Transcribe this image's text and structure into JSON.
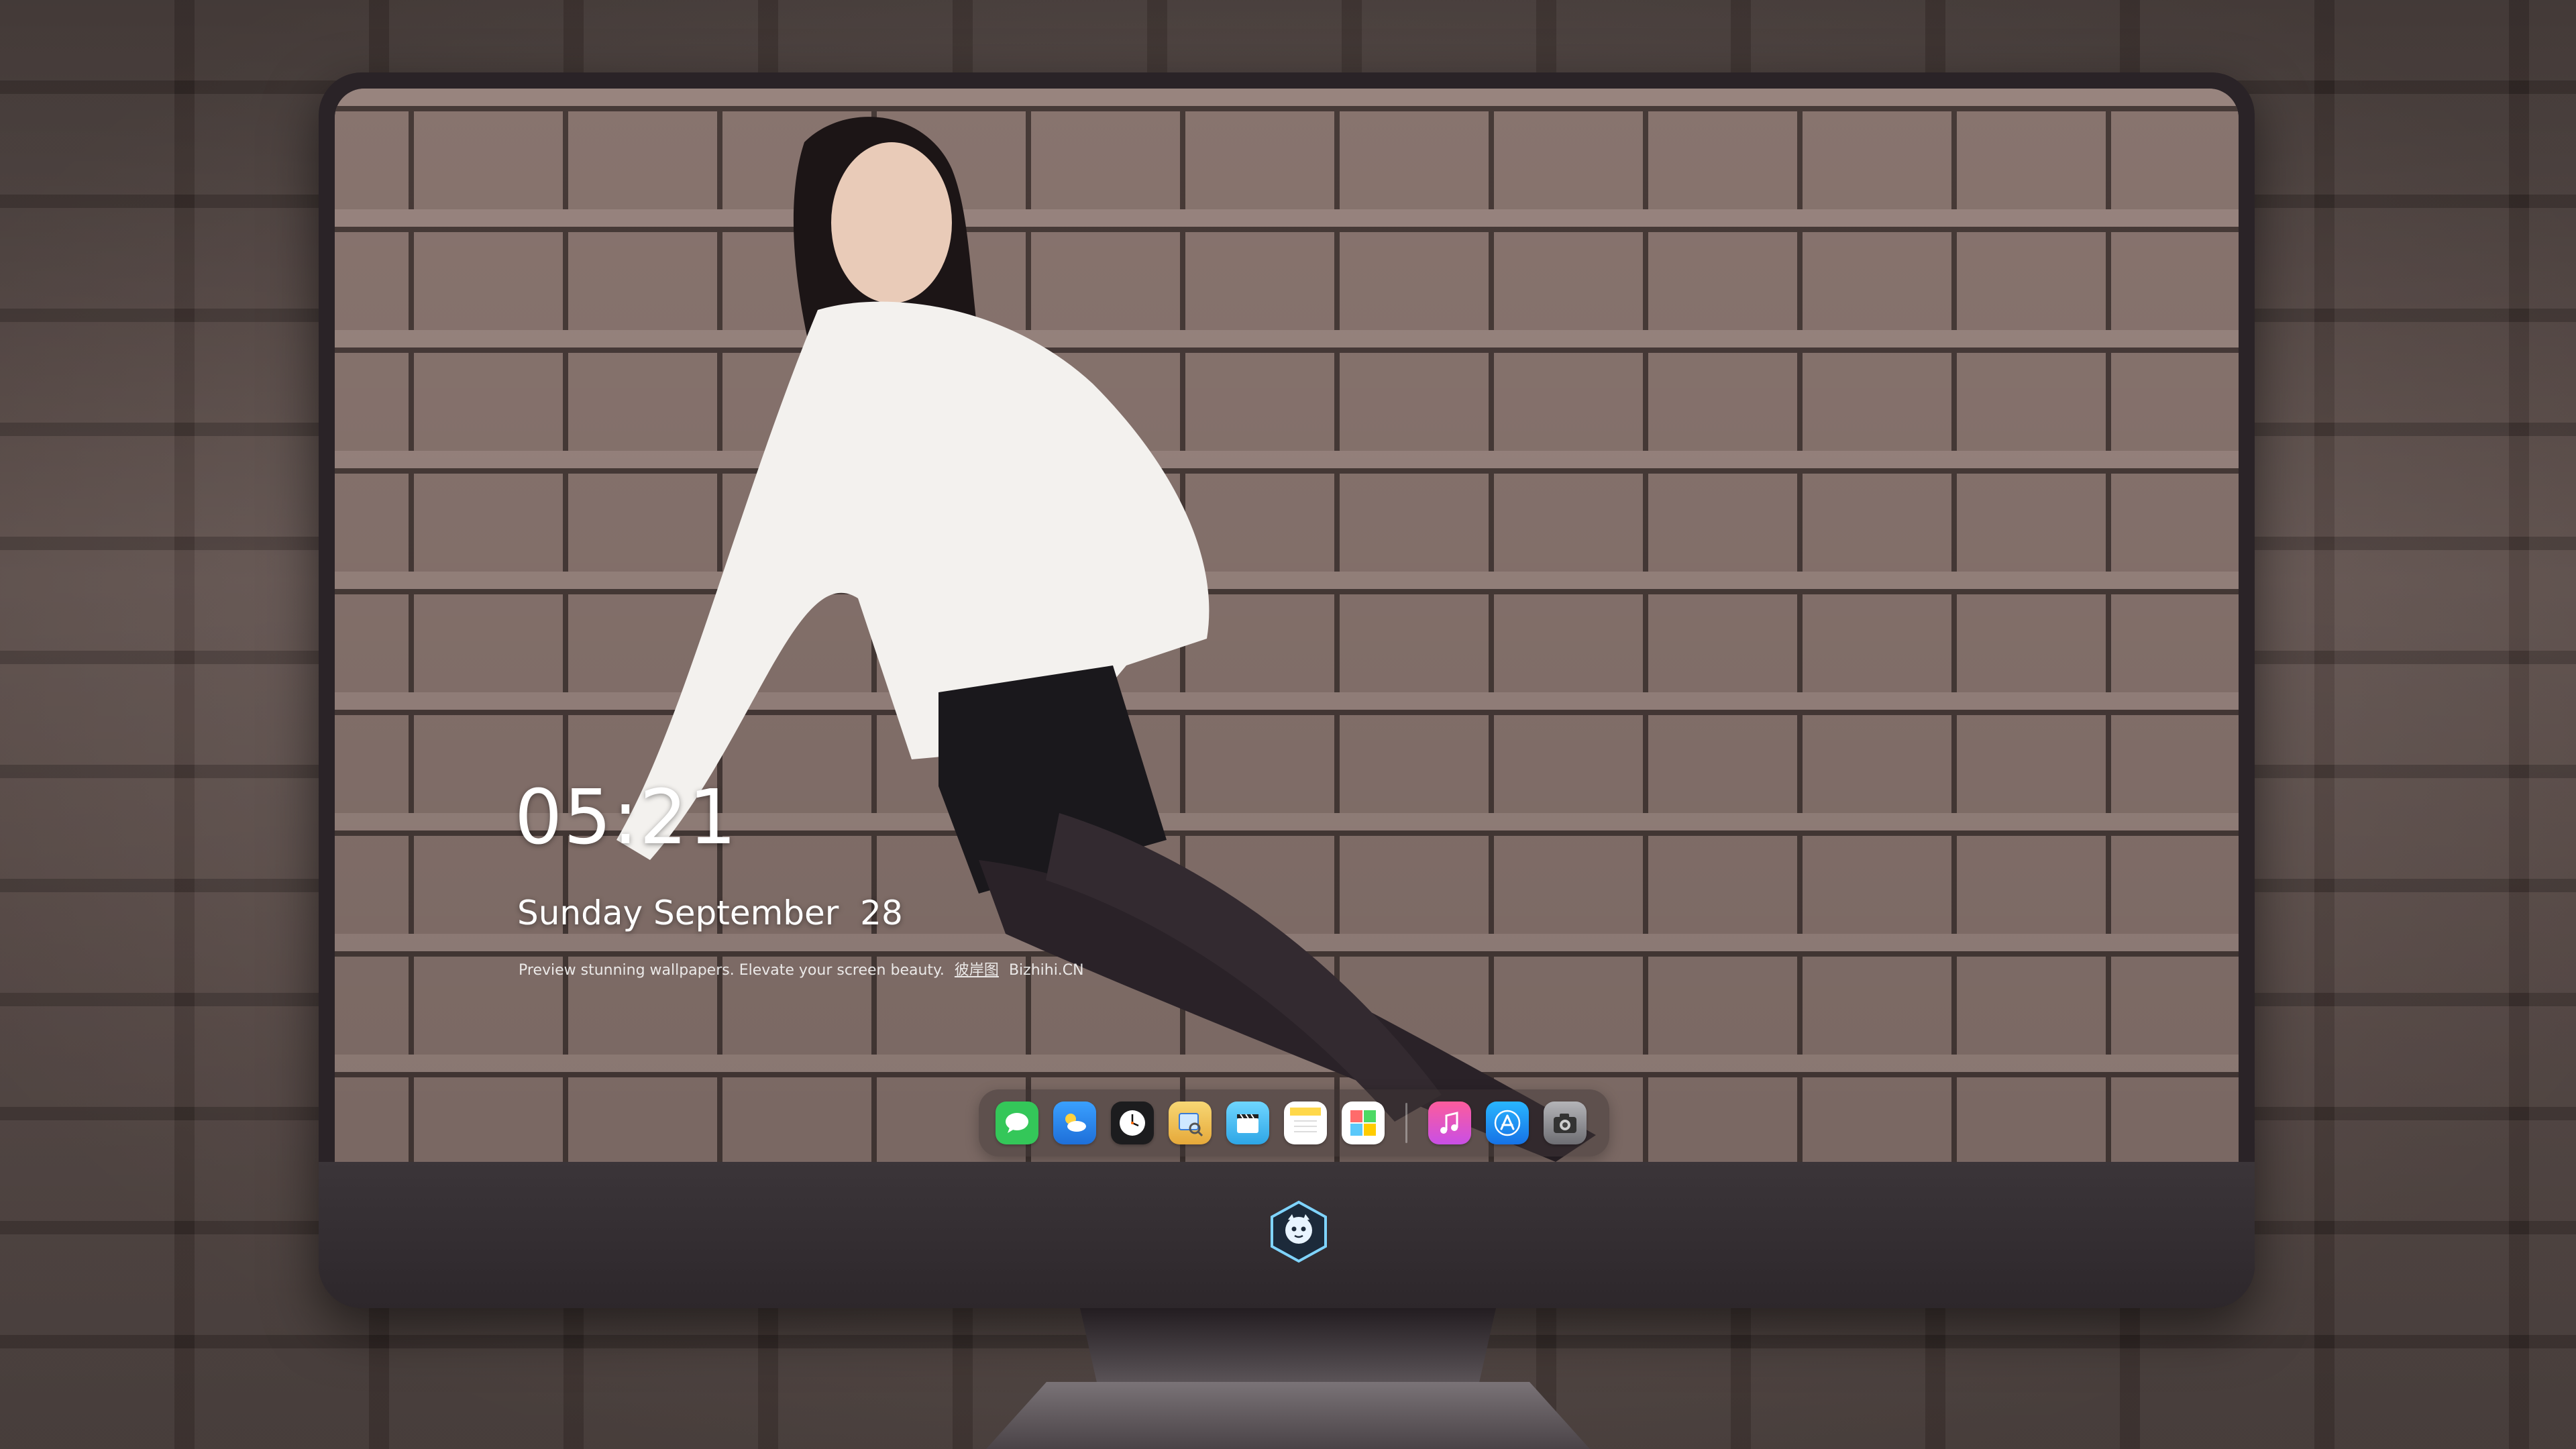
{
  "lockscreen": {
    "time": "05:21",
    "date": "Sunday September  28",
    "tagline": "Preview stunning wallpapers. Elevate your screen beauty.",
    "tagline_cn": "彼岸图",
    "tagline_site": "Bizhihi.CN"
  },
  "dock": {
    "apps": [
      {
        "name": "messages-icon",
        "color": "#34c759"
      },
      {
        "name": "weather-icon",
        "color": "#3aa0ff"
      },
      {
        "name": "clock-icon",
        "color": "#ffffff"
      },
      {
        "name": "preview-icon",
        "color": "#f5c542"
      },
      {
        "name": "clips-icon",
        "color": "#5ac8fa"
      },
      {
        "name": "notes-icon",
        "color": "#ffd84a"
      },
      {
        "name": "photo-booth-icon",
        "color": "#4cd964"
      },
      {
        "name": "music-icon",
        "color": "#fc3c8d"
      },
      {
        "name": "app-store-icon",
        "color": "#1e90ff"
      },
      {
        "name": "camera-icon",
        "color": "#8e8e93"
      }
    ]
  },
  "colors": {
    "bezel": "#2a2327",
    "wall": "#8d7771",
    "grout": "#4a3d3a"
  }
}
